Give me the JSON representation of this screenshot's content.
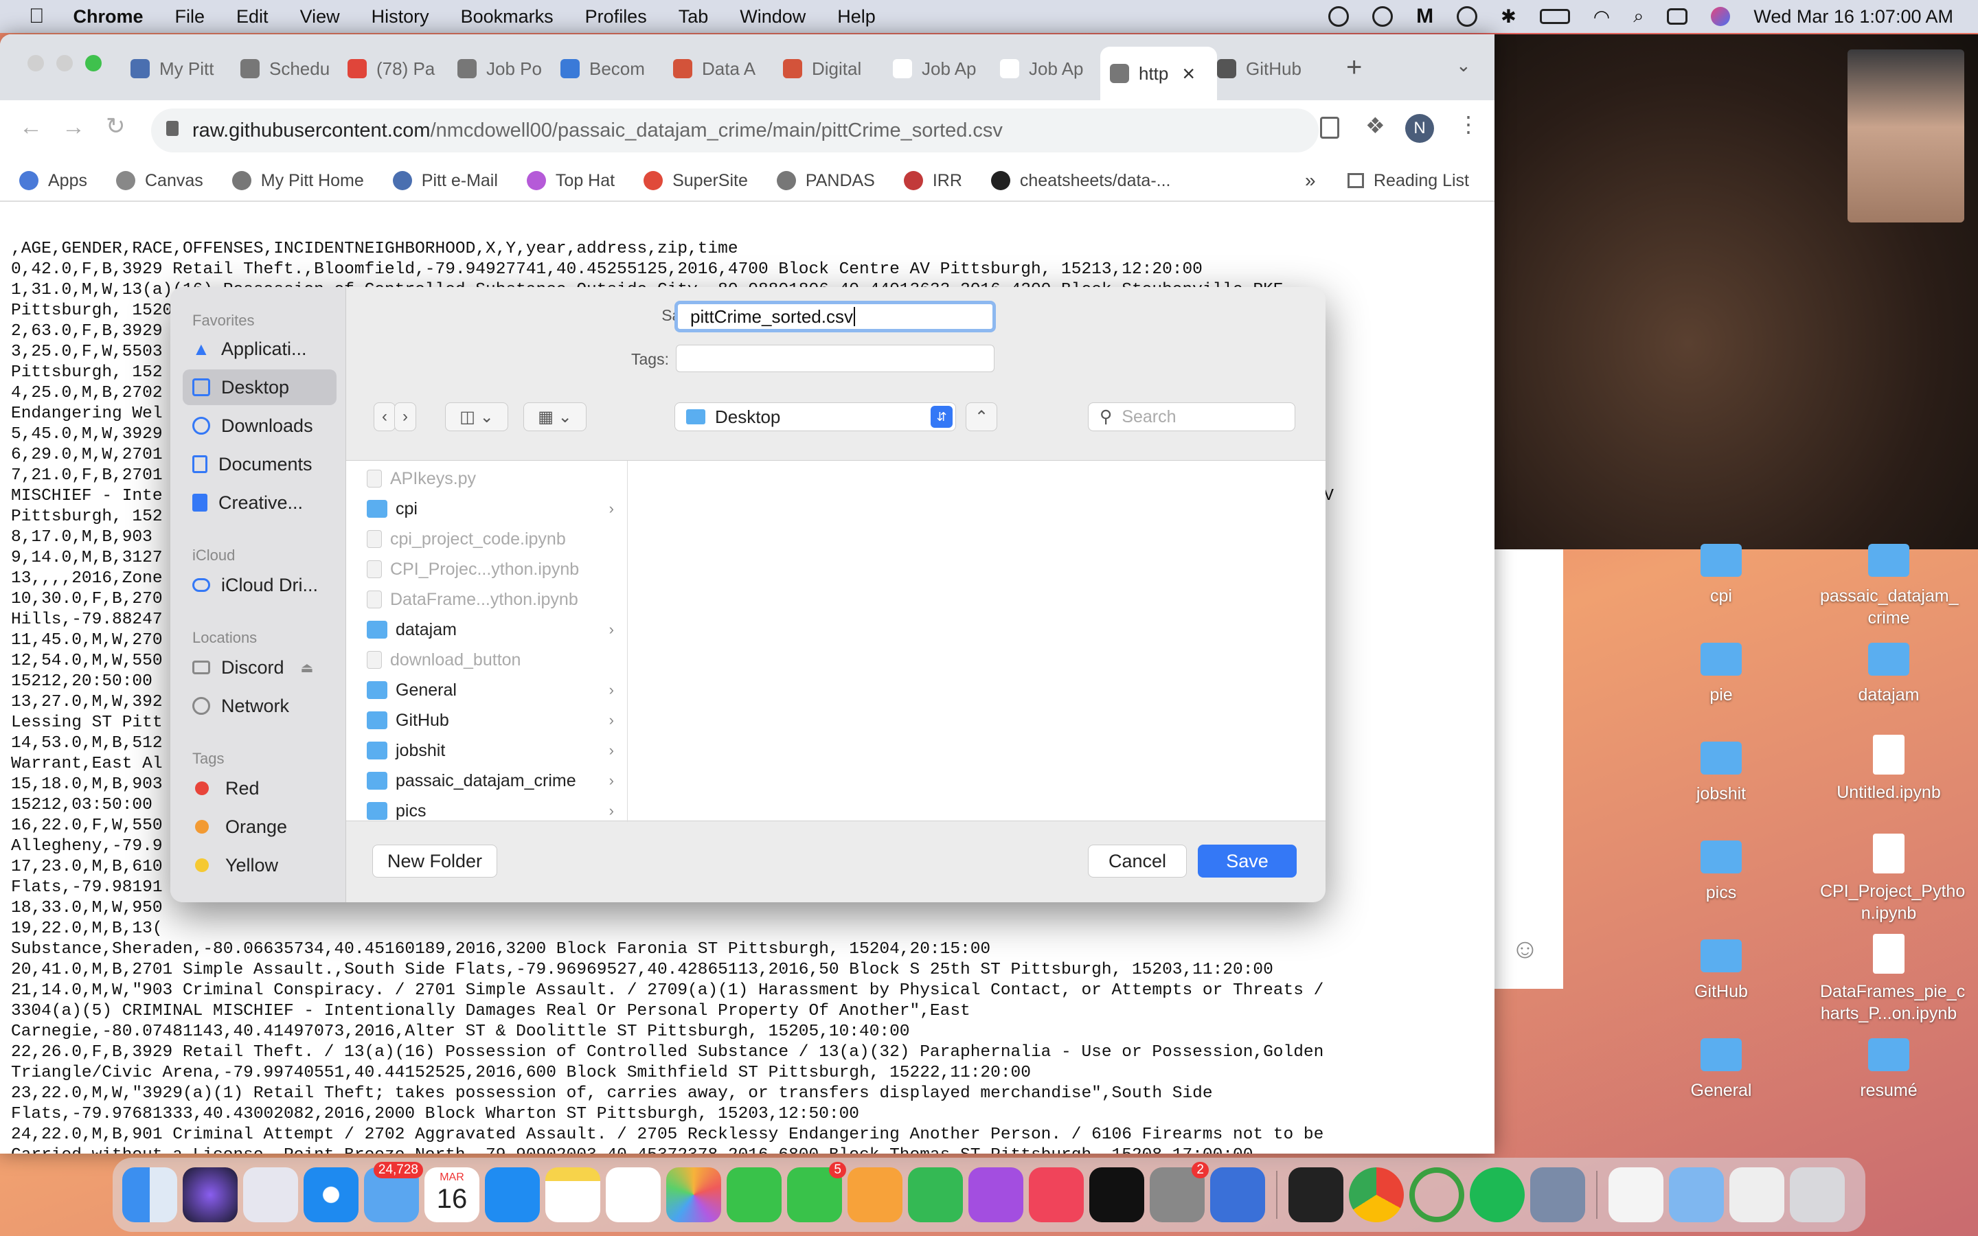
{
  "menubar": {
    "app": "Chrome",
    "items": [
      "File",
      "Edit",
      "View",
      "History",
      "Bookmarks",
      "Profiles",
      "Tab",
      "Window",
      "Help"
    ],
    "clock": "Wed Mar 16  1:07:00 AM"
  },
  "tabs": [
    {
      "label": "My Pitt"
    },
    {
      "label": "Schedu"
    },
    {
      "label": "(78) Pa"
    },
    {
      "label": "Job Po"
    },
    {
      "label": "Becom"
    },
    {
      "label": "Data A"
    },
    {
      "label": "Digital"
    },
    {
      "label": "Job Ap"
    },
    {
      "label": "Job Ap"
    },
    {
      "label": "http"
    },
    {
      "label": "GitHub"
    }
  ],
  "omnibox": {
    "host": "raw.githubusercontent.com",
    "path": "/nmcdowell00/passaic_datajam_crime/main/pittCrime_sorted.csv"
  },
  "profile_initial": "N",
  "bookmarks": [
    "Apps",
    "Canvas",
    "My Pitt Home",
    "Pitt e-Mail",
    "Top Hat",
    "SuperSite",
    "PANDAS",
    "IRR",
    "cheatsheets/data-..."
  ],
  "reading_list": "Reading List",
  "csv_lines": [
    ",AGE,GENDER,RACE,OFFENSES,INCIDENTNEIGHBORHOOD,X,Y,year,address,zip,time",
    "0,42.0,F,B,3929 Retail Theft.,Bloomfield,-79.94927741,40.45255125,2016,4700 Block Centre AV Pittsburgh, 15213,12:20:00",
    "1,31.0,M,W,13(a)(16) Possession of Controlled Substance,Outside City,-80.08801806,40.44013633,2016,4200 Block Steubenville PKE",
    "Pittsburgh, 15205,14:55:00",
    "2,63.0,F,B,3929",
    "3,25.0,F,W,5503                                                                                                         edar AV",
    "Pittsburgh, 152",
    "4,25.0,M,B,2702                                                                                                         )(1)",
    "Endangering Wel                                                                                                         :00",
    "5,45.0,M,W,3929",
    "6,29.0,M,W,2701",
    "7,21.0,F,B,2701                                                                                                         CRIMINAL",
    "MISCHIEF - Inte                                                                                                       S Braddock AV",
    "Pittsburgh, 152",
    "8,17.0,M,B,903                                                                                                         5:00",
    "9,14.0,M,B,3127                                                                                                       person under",
    "13,,,,2016,Zone",
    "10,30.0,F,B,270",
    "Hills,-79.88247",
    "11,45.0,M,W,270",
    "12,54.0,M,W,550                                                                                                        tsburgh,",
    "15212,20:50:00",
    "13,27.0,M,W,392                                                                                                        00 Block",
    "Lessing ST Pitt",
    "14,53.0,M,B,512                                                                                                       9501 Bench",
    "Warrant,East Al",
    "15,18.0,M,B,903                                                                                                        ttsburgh,",
    "15212,03:50:00",
    "16,22.0,F,W,550                                                                                                       mount,East",
    "Allegheny,-79.9",
    "17,23.0,M,B,610",
    "Flats,-79.98191",
    "18,33.0,M,W,950",
    "19,22.0,M,B,13(",
    "Substance,Sheraden,-80.06635734,40.45160189,2016,3200 Block Faronia ST Pittsburgh, 15204,20:15:00",
    "20,41.0,M,B,2701 Simple Assault.,South Side Flats,-79.96969527,40.42865113,2016,50 Block S 25th ST Pittsburgh, 15203,11:20:00",
    "21,14.0,M,W,\"903 Criminal Conspiracy. / 2701 Simple Assault. / 2709(a)(1) Harassment by Physical Contact, or Attempts or Threats /",
    "3304(a)(5) CRIMINAL MISCHIEF - Intentionally Damages Real Or Personal Property Of Another\",East",
    "Carnegie,-80.07481143,40.41497073,2016,Alter ST & Doolittle ST Pittsburgh, 15205,10:40:00",
    "22,26.0,F,B,3929 Retail Theft. / 13(a)(16) Possession of Controlled Substance / 13(a)(32) Paraphernalia - Use or Possession,Golden",
    "Triangle/Civic Arena,-79.99740551,40.44152525,2016,600 Block Smithfield ST Pittsburgh, 15222,11:20:00",
    "23,22.0,M,W,\"3929(a)(1) Retail Theft; takes possession of, carries away, or transfers displayed merchandise\",South Side",
    "Flats,-79.97681333,40.43002082,2016,2000 Block Wharton ST Pittsburgh, 15203,12:50:00",
    "24,22.0,M,B,901 Criminal Attempt / 2702 Aggravated Assault. / 2705 Recklessy Endangering Another Person. / 6106 Firearms not to be",
    "Carried without a License.,Point Breeze North,-79.90902003,40.45372378,2016,6800 Block Thomas ST Pittsburgh, 15208,17:00:00",
    "25,15.0,M,B,\"903 Criminal Conspiracy. / 3702 Robbery of Motor Vehicle. / 4910 Tampering with or Fabricating Physical Evidence. / 5104"
  ],
  "dialog": {
    "save_as_label": "Save As:",
    "filename": "pittCrime_sorted.csv",
    "tags_label": "Tags:",
    "location": "Desktop",
    "search_placeholder": "Search",
    "new_folder": "New Folder",
    "cancel": "Cancel",
    "save": "Save",
    "sidebar": {
      "favorites_header": "Favorites",
      "favorites": [
        "Applicati...",
        "Desktop",
        "Downloads",
        "Documents",
        "Creative..."
      ],
      "icloud_header": "iCloud",
      "icloud": [
        "iCloud Dri..."
      ],
      "locations_header": "Locations",
      "locations": [
        "Discord",
        "Network"
      ],
      "tags_header": "Tags",
      "tags": [
        {
          "name": "Red",
          "color": "#e8443a"
        },
        {
          "name": "Orange",
          "color": "#f29a33"
        },
        {
          "name": "Yellow",
          "color": "#f5c932"
        }
      ]
    },
    "files": [
      {
        "name": "APIkeys.py",
        "type": "file",
        "dim": true
      },
      {
        "name": "cpi",
        "type": "folder",
        "dim": false
      },
      {
        "name": "cpi_project_code.ipynb",
        "type": "file",
        "dim": true
      },
      {
        "name": "CPI_Projec...ython.ipynb",
        "type": "file",
        "dim": true
      },
      {
        "name": "DataFrame...ython.ipynb",
        "type": "file",
        "dim": true
      },
      {
        "name": "datajam",
        "type": "folder",
        "dim": false
      },
      {
        "name": "download_button",
        "type": "file",
        "dim": true
      },
      {
        "name": "General",
        "type": "folder",
        "dim": false
      },
      {
        "name": "GitHub",
        "type": "folder",
        "dim": false
      },
      {
        "name": "jobshit",
        "type": "folder",
        "dim": false
      },
      {
        "name": "passaic_datajam_crime",
        "type": "folder",
        "dim": false
      },
      {
        "name": "pics",
        "type": "folder",
        "dim": false
      }
    ]
  },
  "desktop_icons": [
    {
      "label": "cpi",
      "kind": "folder"
    },
    {
      "label": "passaic_datajam_\ncrime",
      "kind": "folder"
    },
    {
      "label": "pie",
      "kind": "folder"
    },
    {
      "label": "datajam",
      "kind": "folder"
    },
    {
      "label": "jobshit",
      "kind": "folder"
    },
    {
      "label": "Untitled.ipynb",
      "kind": "doc"
    },
    {
      "label": "pics",
      "kind": "folder"
    },
    {
      "label": "CPI_Project_Pytho\nn.ipynb",
      "kind": "doc"
    },
    {
      "label": "GitHub",
      "kind": "folder"
    },
    {
      "label": "DataFrames_pie_c\nharts_P...on.ipynb",
      "kind": "doc"
    },
    {
      "label": "General",
      "kind": "folder"
    },
    {
      "label": "resumé",
      "kind": "folder"
    }
  ],
  "dock": {
    "mail_badge": "24,728",
    "calendar_month": "MAR",
    "calendar_day": "16",
    "facetime_badge": "5",
    "settings_badge": "2"
  }
}
